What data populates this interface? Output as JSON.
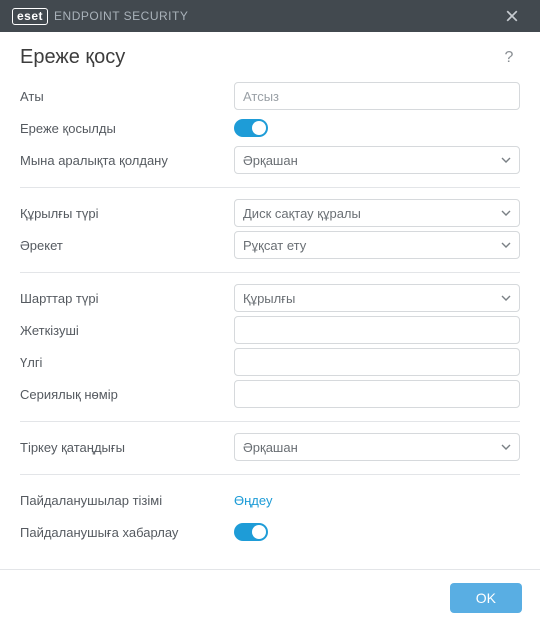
{
  "titlebar": {
    "logo": "eset",
    "product": "ENDPOINT SECURITY"
  },
  "header": {
    "title": "Ереже қосу",
    "help": "?"
  },
  "fields": {
    "name_label": "Аты",
    "name_placeholder": "Атсыз",
    "enabled_label": "Ереже қосылды",
    "apply_during_label": "Мына аралықта қолдану",
    "apply_during_value": "Әрқашан",
    "device_type_label": "Құрылғы түрі",
    "device_type_value": "Диск сақтау құралы",
    "action_label": "Әрекет",
    "action_value": "Рұқсат ету",
    "criteria_type_label": "Шарттар түрі",
    "criteria_type_value": "Құрылғы",
    "vendor_label": "Жеткізуші",
    "vendor_value": "",
    "model_label": "Үлгі",
    "model_value": "",
    "serial_label": "Сериялық нөмір",
    "serial_value": "",
    "severity_label": "Тіркеу қатаңдығы",
    "severity_value": "Әрқашан",
    "users_label": "Пайдаланушылар тізімі",
    "users_link": "Өңдеу",
    "notify_label": "Пайдаланушыға хабарлау"
  },
  "footer": {
    "ok": "OK"
  }
}
